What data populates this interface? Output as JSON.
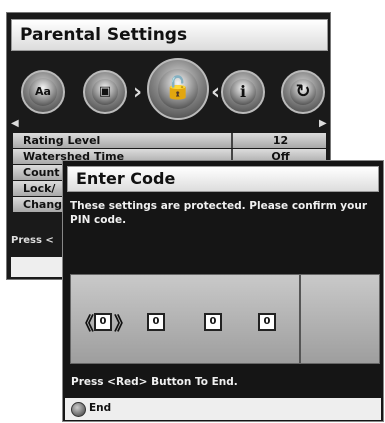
{
  "parental": {
    "title": "Parental Settings",
    "icons": [
      {
        "name": "language-icon",
        "glyph": "Aa"
      },
      {
        "name": "media-icon",
        "glyph": "▣"
      },
      {
        "name": "lock-icon",
        "glyph": "🔓"
      },
      {
        "name": "info-icon",
        "glyph": "i"
      },
      {
        "name": "refresh-icon",
        "glyph": "↻"
      }
    ],
    "rows": [
      {
        "label": "Rating Level",
        "value": "12"
      },
      {
        "label": "Watershed Time",
        "value": "Off"
      },
      {
        "label": "Count",
        "value": ""
      },
      {
        "label": "Lock/",
        "value": ""
      },
      {
        "label": "Chang",
        "value": ""
      }
    ],
    "hint": "Press <"
  },
  "dialog": {
    "title": "Enter Code",
    "message_line1": "These settings are protected. Please confirm your",
    "message_line2": "PIN code.",
    "pin_digits": [
      "0",
      "0",
      "0",
      "0"
    ],
    "left_arrow": "《",
    "right_arrow": "》",
    "hint": "Press <Red> Button To End.",
    "end_label": "End",
    "end_color": "#888888"
  }
}
